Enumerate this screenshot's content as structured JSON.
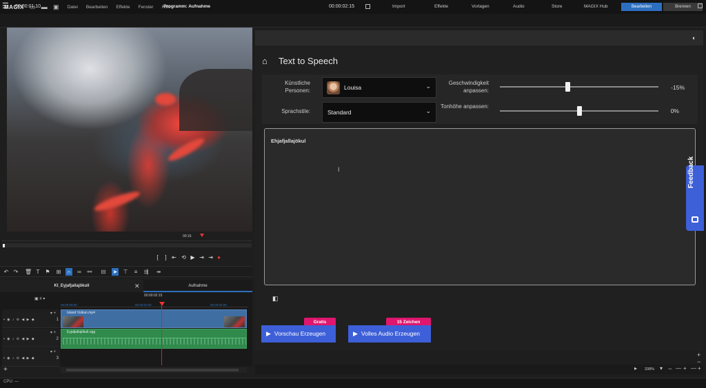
{
  "app": {
    "logo": "MAGIX",
    "menu": [
      "Datei",
      "Bearbeiten",
      "Effekte",
      "Fenster",
      "Hilfe"
    ],
    "mode_edit": "Bearbeiten",
    "mode_burn": "Brennen"
  },
  "toolbar2": {
    "timecode_left": "00:00:01:10",
    "program_label": "Programm: Aufnahme",
    "timecode_right": "00:00:02:15",
    "tabs": [
      "Import",
      "Effekte",
      "Vorlagen",
      "Audio",
      "Store",
      "MAGIX Hub"
    ]
  },
  "preview": {
    "scrub_time": "00:15"
  },
  "project_tabs": {
    "tab1": "KI_Eyjafjallajökull",
    "tab2": "Aufnahme"
  },
  "timeline": {
    "timecode": "00:00:02:15",
    "ruler_ticks": [
      "00:00:00:00",
      "00:00:02:00",
      "00:00:04:00"
    ],
    "tracks": [
      {
        "number": "1",
        "clip": "Island Vulkan.mp4"
      },
      {
        "number": "2",
        "clip": "Eyjafjallajökull.ogg"
      },
      {
        "number": "3",
        "clip": ""
      }
    ]
  },
  "tts": {
    "title": "Text to Speech",
    "persons_label": "Künstliche Personen:",
    "persons_value": "Louisa",
    "style_label": "Sprachstile:",
    "style_value": "Standard",
    "speed_label": "Geschwindigkeit anpassen:",
    "speed_value": "-15%",
    "speed_level": -15,
    "pitch_label": "Tonhöhe anpassen:",
    "pitch_value": "0%",
    "pitch_level": 0,
    "text": "Ehjafjallajökul",
    "preview_button": "Vorschau Erzeugen",
    "preview_badge": "Gratis",
    "full_button": "Volles Audio Erzeugen",
    "full_badge": "15 Zeichen"
  },
  "feedback": {
    "label": "Feedback"
  },
  "zoom": {
    "value": "338%"
  },
  "status": {
    "cpu_label": "CPU: —"
  },
  "colors": {
    "accent_blue": "#3d5fd8",
    "mode_active": "#2d6fbf",
    "badge_pink": "#e0166e",
    "video_clip": "#3f6ea3",
    "audio_clip": "#2f8a4c",
    "playhead": "#dd2222"
  }
}
